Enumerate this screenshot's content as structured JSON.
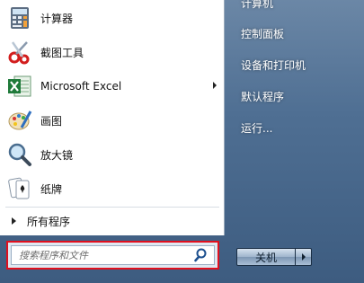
{
  "programs": [
    {
      "label": "计算器",
      "icon": "calculator-icon"
    },
    {
      "label": "截图工具",
      "icon": "snipping-tool-icon"
    },
    {
      "label": "Microsoft Excel",
      "icon": "excel-icon",
      "has_submenu": true
    },
    {
      "label": "画图",
      "icon": "paint-icon"
    },
    {
      "label": "放大镜",
      "icon": "magnifier-icon"
    },
    {
      "label": "纸牌",
      "icon": "solitaire-icon"
    }
  ],
  "all_programs": {
    "label": "所有程序"
  },
  "search": {
    "placeholder": "搜索程序和文件",
    "icon": "search-icon"
  },
  "right_links": [
    {
      "label": "计算机"
    },
    {
      "label": "控制面板"
    },
    {
      "label": "设备和打印机"
    },
    {
      "label": "默认程序"
    },
    {
      "label": "运行..."
    }
  ],
  "shutdown": {
    "label": "关机"
  },
  "colors": {
    "highlight_border": "#e0101f",
    "right_pane_bg": "#4f6f93",
    "excel_green": "#1f7a3a"
  }
}
